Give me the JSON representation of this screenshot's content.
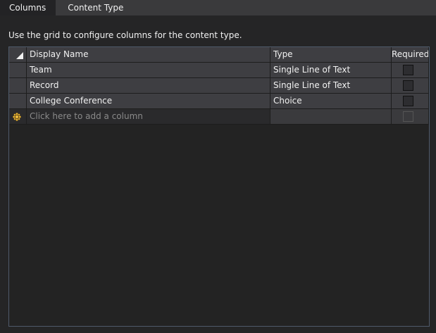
{
  "tabs": [
    {
      "label": "Columns",
      "active": true
    },
    {
      "label": "Content Type",
      "active": false
    }
  ],
  "description": "Use the grid to configure columns for the content type.",
  "grid": {
    "headers": {
      "display_name": "Display Name",
      "type": "Type",
      "required": "Required"
    },
    "rows": [
      {
        "display_name": "Team",
        "type": "Single Line of Text",
        "required": false
      },
      {
        "display_name": "Record",
        "type": "Single Line of Text",
        "required": false
      },
      {
        "display_name": "College Conference",
        "type": "Choice",
        "required": false
      }
    ],
    "new_row_placeholder": "Click here to add a column"
  },
  "colors": {
    "background": "#252526",
    "tab_bar": "#3a3a3c",
    "grid_border": "#4e5a6a",
    "cell": "#3e3e42"
  }
}
